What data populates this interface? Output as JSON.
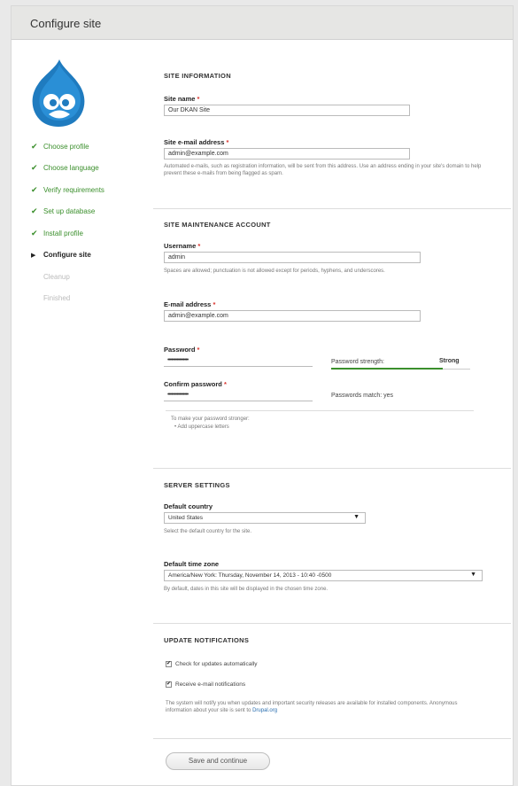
{
  "window": {
    "title": "Configure site"
  },
  "sidebar": {
    "steps": [
      {
        "label": "Choose profile",
        "state": "done"
      },
      {
        "label": "Choose language",
        "state": "done"
      },
      {
        "label": "Verify requirements",
        "state": "done"
      },
      {
        "label": "Set up database",
        "state": "done"
      },
      {
        "label": "Install profile",
        "state": "done"
      },
      {
        "label": "Configure site",
        "state": "current"
      },
      {
        "label": "Cleanup",
        "state": "todo"
      },
      {
        "label": "Finished",
        "state": "todo"
      }
    ]
  },
  "site_info": {
    "heading": "SITE INFORMATION",
    "site_name_label": "Site name",
    "site_name_value": "Our DKAN Site",
    "email_label": "Site e-mail address",
    "email_value": "admin@example.com",
    "email_desc": "Automated e-mails, such as registration information, will be sent from this address. Use an address ending in your site's domain to help prevent these e-mails from being flagged as spam."
  },
  "maintenance": {
    "heading": "SITE MAINTENANCE ACCOUNT",
    "username_label": "Username",
    "username_value": "admin",
    "username_desc": "Spaces are allowed; punctuation is not allowed except for periods, hyphens, and underscores.",
    "email_label": "E-mail address",
    "email_value": "admin@example.com",
    "password_label": "Password",
    "password_value": "••••••••••••••••",
    "strength_label": "Password strength:",
    "strength_value": "Strong",
    "strength_fraction": 0.8,
    "confirm_label": "Confirm password",
    "confirm_value": "••••••••••••••••",
    "match_text": "Passwords match: yes",
    "suggest_title": "To make your password stronger:",
    "suggest_item": "Add uppercase letters"
  },
  "server": {
    "heading": "SERVER SETTINGS",
    "country_label": "Default country",
    "country_value": "United States",
    "country_desc": "Select the default country for the site.",
    "tz_label": "Default time zone",
    "tz_value": "America/New York: Thursday, November 14, 2013 - 10:40 -0500",
    "tz_desc": "By default, dates in this site will be displayed in the chosen time zone."
  },
  "updates": {
    "heading": "UPDATE NOTIFICATIONS",
    "check_label": "Check for updates automatically",
    "notify_label": "Receive e-mail notifications",
    "desc_text": "The system will notify you when updates and important security releases are available for installed components. Anonymous information about your site is sent to",
    "desc_link": "Drupal.org"
  },
  "actions": {
    "submit_label": "Save and continue"
  },
  "colors": {
    "accent_green": "#3b8f2c",
    "required_red": "#d9302a",
    "link_blue": "#2a6fb0"
  },
  "icons": {
    "logo": "drupal-drop-logo",
    "done": "check-icon",
    "current": "triangle-right-icon"
  }
}
